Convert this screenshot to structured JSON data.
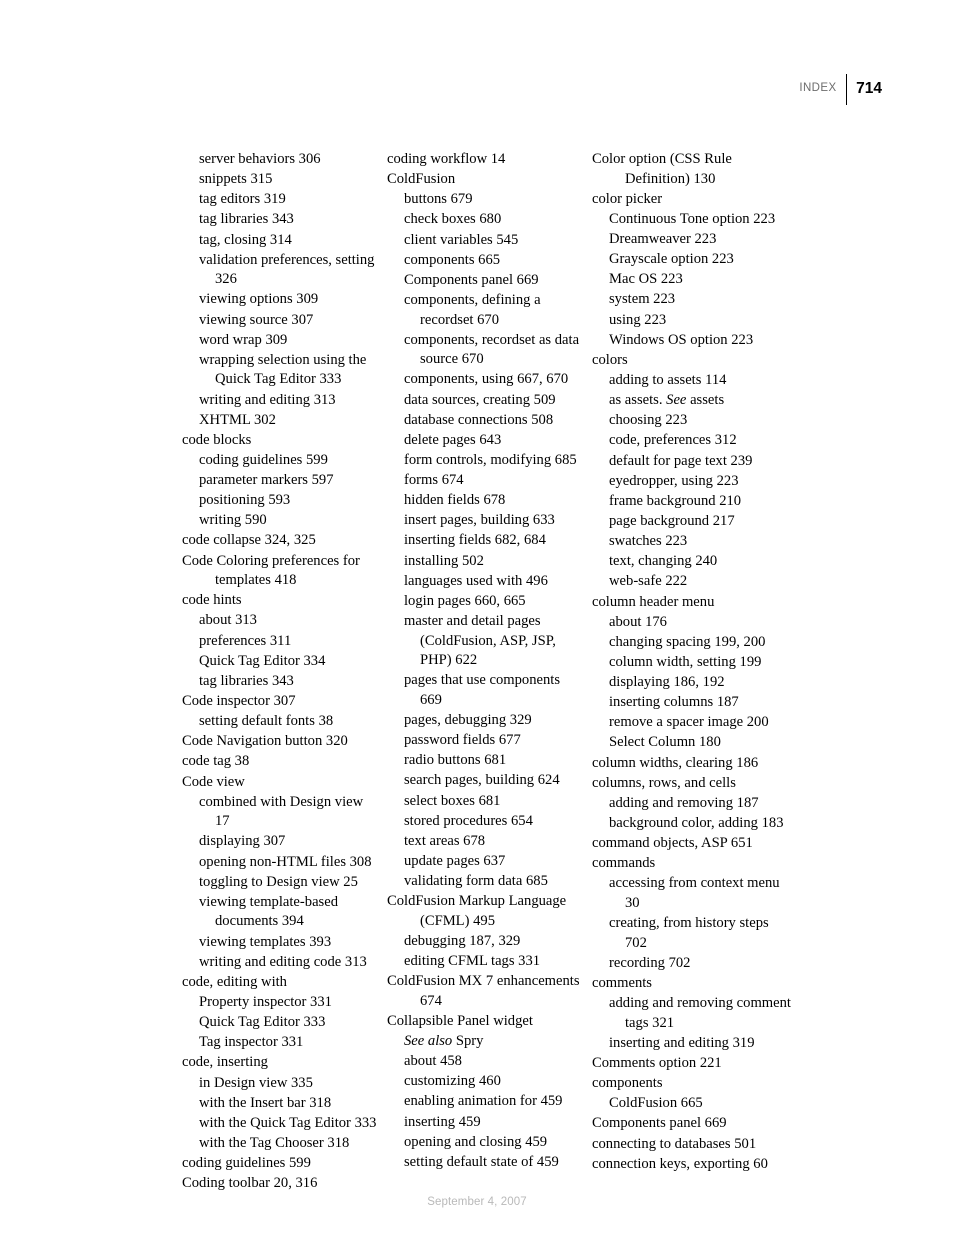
{
  "header": {
    "label": "INDEX",
    "page_number": "714"
  },
  "footer": {
    "date": "September 4, 2007"
  },
  "colors": {
    "text": "#000000",
    "header_label": "#6d6d6d",
    "footer": "#b9b9b9",
    "rule": "#000000",
    "page_background": "#ffffff"
  },
  "columns": [
    {
      "id": "column-1",
      "entries": [
        {
          "level": 2,
          "text": "server behaviors 306"
        },
        {
          "level": 2,
          "text": "snippets 315"
        },
        {
          "level": 2,
          "text": "tag editors 319"
        },
        {
          "level": 2,
          "text": "tag libraries 343"
        },
        {
          "level": 2,
          "text": "tag, closing 314"
        },
        {
          "level": 2,
          "text": "validation preferences, setting 326"
        },
        {
          "level": 2,
          "text": "viewing options 309"
        },
        {
          "level": 2,
          "text": "viewing source 307"
        },
        {
          "level": 2,
          "text": "word wrap 309"
        },
        {
          "level": 2,
          "text": "wrapping selection using the Quick Tag Editor 333"
        },
        {
          "level": 2,
          "text": "writing and editing 313"
        },
        {
          "level": 2,
          "text": "XHTML 302"
        },
        {
          "level": 1,
          "text": "code blocks"
        },
        {
          "level": 2,
          "text": "coding guidelines 599"
        },
        {
          "level": 2,
          "text": "parameter markers 597"
        },
        {
          "level": 2,
          "text": "positioning 593"
        },
        {
          "level": 2,
          "text": "writing 590"
        },
        {
          "level": 1,
          "text": "code collapse 324, 325"
        },
        {
          "level": 1,
          "text": "Code Coloring preferences for templates 418"
        },
        {
          "level": 1,
          "text": "code hints"
        },
        {
          "level": 2,
          "text": "about 313"
        },
        {
          "level": 2,
          "text": "preferences 311"
        },
        {
          "level": 2,
          "text": "Quick Tag Editor 334"
        },
        {
          "level": 2,
          "text": "tag libraries 343"
        },
        {
          "level": 1,
          "text": "Code inspector 307"
        },
        {
          "level": 2,
          "text": "setting default fonts 38"
        },
        {
          "level": 1,
          "text": "Code Navigation button 320"
        },
        {
          "level": 1,
          "text": "code tag 38"
        },
        {
          "level": 1,
          "text": "Code view"
        },
        {
          "level": 2,
          "text": "combined with Design view 17"
        },
        {
          "level": 2,
          "text": "displaying 307"
        },
        {
          "level": 2,
          "text": "opening non-HTML files 308"
        },
        {
          "level": 2,
          "text": "toggling to Design view 25"
        },
        {
          "level": 2,
          "text": "viewing template-based documents 394"
        },
        {
          "level": 2,
          "text": "viewing templates 393"
        },
        {
          "level": 2,
          "text": "writing and editing code 313"
        },
        {
          "level": 1,
          "text": "code, editing with"
        },
        {
          "level": 2,
          "text": "Property inspector 331"
        },
        {
          "level": 2,
          "text": "Quick Tag Editor 333"
        },
        {
          "level": 2,
          "text": "Tag inspector 331"
        },
        {
          "level": 1,
          "text": "code, inserting"
        },
        {
          "level": 2,
          "text": "in Design view 335"
        },
        {
          "level": 2,
          "text": "with the Insert bar 318"
        },
        {
          "level": 2,
          "text": "with the Quick Tag Editor 333"
        },
        {
          "level": 2,
          "text": "with the Tag Chooser 318"
        },
        {
          "level": 1,
          "text": "coding guidelines 599"
        },
        {
          "level": 1,
          "text": "Coding toolbar 20, 316"
        }
      ]
    },
    {
      "id": "column-2",
      "entries": [
        {
          "level": 1,
          "text": "coding workflow 14"
        },
        {
          "level": 1,
          "text": "ColdFusion"
        },
        {
          "level": 2,
          "text": "buttons 679"
        },
        {
          "level": 2,
          "text": "check boxes 680"
        },
        {
          "level": 2,
          "text": "client variables 545"
        },
        {
          "level": 2,
          "text": "components 665"
        },
        {
          "level": 2,
          "text": "Components panel 669"
        },
        {
          "level": 2,
          "text": "components, defining a recordset 670"
        },
        {
          "level": 2,
          "text": "components, recordset as data source 670"
        },
        {
          "level": 2,
          "text": "components, using 667, 670"
        },
        {
          "level": 2,
          "text": "data sources, creating 509"
        },
        {
          "level": 2,
          "text": "database connections 508"
        },
        {
          "level": 2,
          "text": "delete pages 643"
        },
        {
          "level": 2,
          "text": "form controls, modifying 685"
        },
        {
          "level": 2,
          "text": "forms 674"
        },
        {
          "level": 2,
          "text": "hidden fields 678"
        },
        {
          "level": 2,
          "text": "insert pages, building 633"
        },
        {
          "level": 2,
          "text": "inserting fields 682, 684"
        },
        {
          "level": 2,
          "text": "installing 502"
        },
        {
          "level": 2,
          "text": "languages used with 496"
        },
        {
          "level": 2,
          "text": "login pages 660, 665"
        },
        {
          "level": 2,
          "text": "master and detail pages (ColdFusion, ASP, JSP, PHP) 622"
        },
        {
          "level": 2,
          "text": "pages that use components 669"
        },
        {
          "level": 2,
          "text": "pages, debugging 329"
        },
        {
          "level": 2,
          "text": "password fields 677"
        },
        {
          "level": 2,
          "text": "radio buttons 681"
        },
        {
          "level": 2,
          "text": "search pages, building 624"
        },
        {
          "level": 2,
          "text": "select boxes 681"
        },
        {
          "level": 2,
          "text": "stored procedures 654"
        },
        {
          "level": 2,
          "text": "text areas 678"
        },
        {
          "level": 2,
          "text": "update pages 637"
        },
        {
          "level": 2,
          "text": "validating form data 685"
        },
        {
          "level": 1,
          "text": "ColdFusion Markup Language (CFML) 495"
        },
        {
          "level": 2,
          "text": "debugging 187, 329"
        },
        {
          "level": 2,
          "text": "editing CFML tags 331"
        },
        {
          "level": 1,
          "text": "ColdFusion MX 7 enhancements 674"
        },
        {
          "level": 1,
          "text": "Collapsible Panel widget"
        },
        {
          "level": 2,
          "text": "See also Spry",
          "italic_prefix": "See also",
          "rest": " Spry"
        },
        {
          "level": 2,
          "text": "about 458"
        },
        {
          "level": 2,
          "text": "customizing 460"
        },
        {
          "level": 2,
          "text": "enabling animation for 459"
        },
        {
          "level": 2,
          "text": "inserting 459"
        },
        {
          "level": 2,
          "text": "opening and closing 459"
        },
        {
          "level": 2,
          "text": "setting default state of 459"
        }
      ]
    },
    {
      "id": "column-3",
      "entries": [
        {
          "level": 1,
          "text": "Color option (CSS Rule Definition) 130"
        },
        {
          "level": 1,
          "text": "color picker"
        },
        {
          "level": 2,
          "text": "Continuous Tone option 223"
        },
        {
          "level": 2,
          "text": "Dreamweaver 223"
        },
        {
          "level": 2,
          "text": "Grayscale option 223"
        },
        {
          "level": 2,
          "text": "Mac OS 223"
        },
        {
          "level": 2,
          "text": "system 223"
        },
        {
          "level": 2,
          "text": "using 223"
        },
        {
          "level": 2,
          "text": "Windows OS option 223"
        },
        {
          "level": 1,
          "text": "colors"
        },
        {
          "level": 2,
          "text": "adding to assets 114"
        },
        {
          "level": 2,
          "text": "as assets. See assets",
          "italic_mid": "See",
          "pre": "as assets. ",
          "post": " assets"
        },
        {
          "level": 2,
          "text": "choosing 223"
        },
        {
          "level": 2,
          "text": "code, preferences 312"
        },
        {
          "level": 2,
          "text": "default for page text 239"
        },
        {
          "level": 2,
          "text": "eyedropper, using 223"
        },
        {
          "level": 2,
          "text": "frame background 210"
        },
        {
          "level": 2,
          "text": "page background 217"
        },
        {
          "level": 2,
          "text": "swatches 223"
        },
        {
          "level": 2,
          "text": "text, changing 240"
        },
        {
          "level": 2,
          "text": "web-safe 222"
        },
        {
          "level": 1,
          "text": "column header menu"
        },
        {
          "level": 2,
          "text": "about 176"
        },
        {
          "level": 2,
          "text": "changing spacing 199, 200"
        },
        {
          "level": 2,
          "text": "column width, setting 199"
        },
        {
          "level": 2,
          "text": "displaying 186, 192"
        },
        {
          "level": 2,
          "text": "inserting columns 187"
        },
        {
          "level": 2,
          "text": "remove a spacer image 200"
        },
        {
          "level": 2,
          "text": "Select Column 180"
        },
        {
          "level": 1,
          "text": "column widths, clearing 186"
        },
        {
          "level": 1,
          "text": "columns, rows, and cells"
        },
        {
          "level": 2,
          "text": "adding and removing 187"
        },
        {
          "level": 2,
          "text": "background color, adding 183"
        },
        {
          "level": 1,
          "text": "command objects, ASP 651"
        },
        {
          "level": 1,
          "text": "commands"
        },
        {
          "level": 2,
          "text": "accessing from context menu 30"
        },
        {
          "level": 2,
          "text": "creating, from history steps 702"
        },
        {
          "level": 2,
          "text": "recording 702"
        },
        {
          "level": 1,
          "text": "comments"
        },
        {
          "level": 2,
          "text": "adding and removing comment tags 321"
        },
        {
          "level": 2,
          "text": "inserting and editing 319"
        },
        {
          "level": 1,
          "text": "Comments option 221"
        },
        {
          "level": 1,
          "text": "components"
        },
        {
          "level": 2,
          "text": "ColdFusion 665"
        },
        {
          "level": 1,
          "text": "Components panel 669"
        },
        {
          "level": 1,
          "text": "connecting to databases 501"
        },
        {
          "level": 1,
          "text": "connection keys, exporting 60"
        }
      ]
    }
  ]
}
